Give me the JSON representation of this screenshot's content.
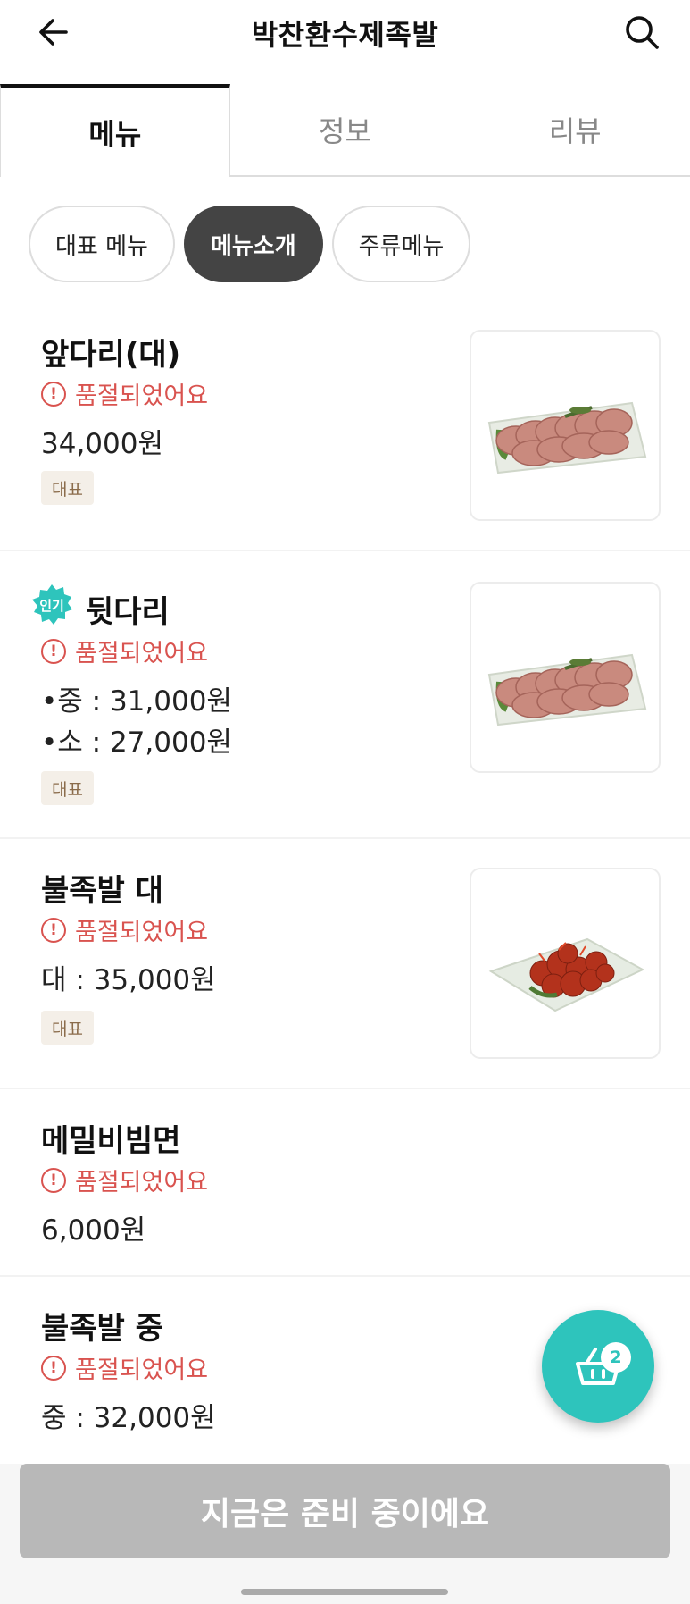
{
  "header": {
    "title": "박찬환수제족발",
    "back_icon": "arrow-left-icon",
    "search_icon": "search-icon"
  },
  "tabs": [
    {
      "label": "메뉴",
      "active": true
    },
    {
      "label": "정보",
      "active": false
    },
    {
      "label": "리뷰",
      "active": false
    }
  ],
  "chips": [
    {
      "label": "대표 메뉴",
      "selected": false
    },
    {
      "label": "메뉴소개",
      "selected": true
    },
    {
      "label": "주류메뉴",
      "selected": false
    }
  ],
  "menu": {
    "items": [
      {
        "name": "앞다리(대)",
        "status": "품절되었어요",
        "prices": [
          "34,000원"
        ],
        "badge": "대표",
        "has_image": true,
        "image_icon": "sliced-pork-hock-plate"
      },
      {
        "name": "뒷다리",
        "popular_label": "인기",
        "status": "품절되었어요",
        "prices": [
          "•중 : 31,000원",
          "•소 : 27,000원"
        ],
        "badge": "대표",
        "has_image": true,
        "image_icon": "sliced-pork-hock-plate"
      },
      {
        "name": "불족발 대",
        "status": "품절되었어요",
        "prices": [
          "대 : 35,000원"
        ],
        "badge": "대표",
        "has_image": true,
        "image_icon": "spicy-pork-feet-plate"
      },
      {
        "name": "메밀비빔면",
        "status": "품절되었어요",
        "prices": [
          "6,000원"
        ]
      },
      {
        "name": "불족발 중",
        "status": "품절되었어요",
        "prices": [
          "중 : 32,000원"
        ]
      }
    ]
  },
  "cart": {
    "icon": "basket-icon",
    "count": "2"
  },
  "order_button": {
    "label": "지금은 준비 중이에요"
  },
  "colors": {
    "accent": "#2ec4bc",
    "soldout": "#d9534f",
    "chip_selected": "#444444",
    "disabled_button": "#b8b8b8"
  }
}
